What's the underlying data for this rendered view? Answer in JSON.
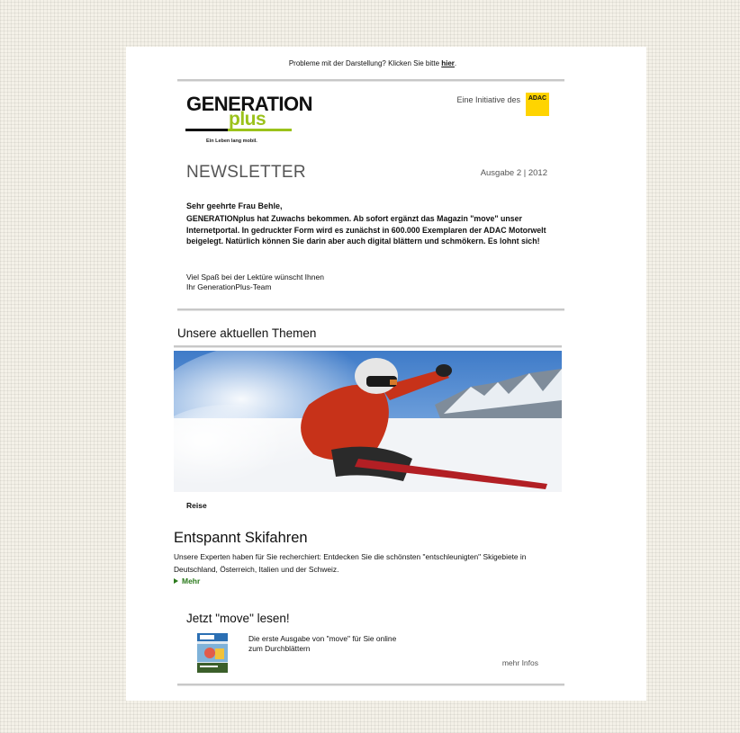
{
  "preheader": {
    "text": "Probleme mit der Darstellung? Klicken Sie bitte ",
    "link": "hier"
  },
  "brand": {
    "logo_top": "GENERATION",
    "logo_bottom": "plus",
    "slogan": "Ein Leben lang mobil.",
    "initiative_text": "Eine Initiative des",
    "adac_label": "ADAC",
    "colors": {
      "green": "#9bc21b",
      "adac_yellow": "#ffd400",
      "link_green": "#2b7a1c"
    }
  },
  "newsletter": {
    "title": "NEWSLETTER",
    "issue": "Ausgabe 2  | 2012",
    "salutation": "Sehr geehrte Frau Behle,",
    "intro": "GENERATIONplus hat Zuwachs bekommen. Ab sofort ergänzt das Magazin \"move\" unser Internetportal. In gedruckter Form wird es zunächst in 600.000 Exemplaren der ADAC Motorwelt beigelegt. Natürlich können Sie darin aber auch digital blättern und schmökern. Es lohnt sich!",
    "closing_line1": "Viel Spaß bei der Lektüre wünscht Ihnen",
    "closing_line2": "Ihr GenerationPlus-Team"
  },
  "themes": {
    "heading": "Unsere aktuellen Themen",
    "hero_image": "skier-in-powder-snow",
    "caption": "Reise",
    "article_title": "Entspannt Skifahren",
    "article_text": "Unsere Experten haben für Sie recherchiert: Entdecken Sie die schönsten \"entschleunigten\" Skigebiete in Deutschland, Österreich, Italien und der Schweiz.",
    "more_label": "Mehr"
  },
  "move": {
    "heading": "Jetzt \"move\" lesen!",
    "thumb_image": "move-magazine-cover",
    "text": "Die erste Ausgabe von \"move\" für Sie online zum Durchblättern",
    "more_label": "mehr Infos"
  }
}
